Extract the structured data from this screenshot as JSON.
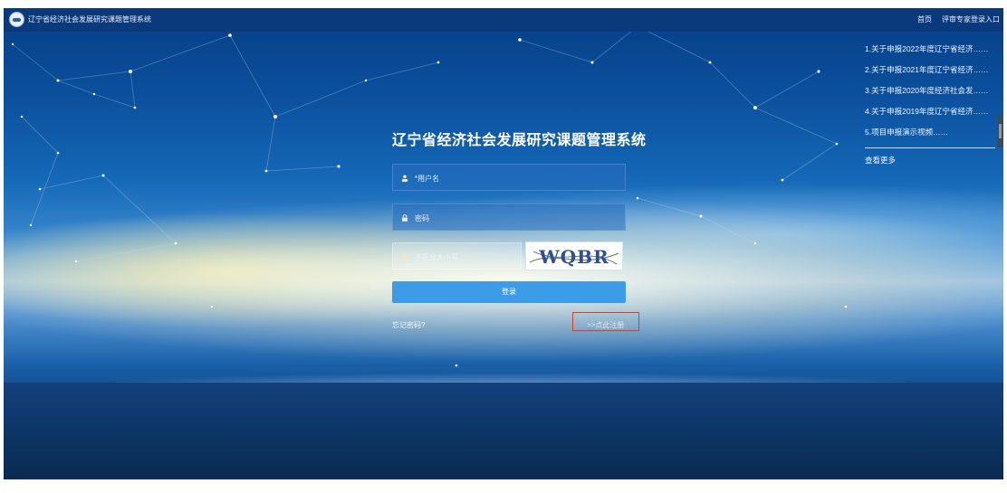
{
  "header": {
    "app_title": "辽宁省经济社会发展研究课题管理系统",
    "nav": {
      "home": "首页",
      "expert_login": "评审专家登录入口"
    }
  },
  "notices": {
    "items": [
      "1.关于申报2022年度辽宁省经济……",
      "2.关于申报2021年度辽宁省经济……",
      "3.关于申报2020年度经济社会发……",
      "4.关于申报2019年度辽宁省经济……",
      "5.项目申报演示视频……"
    ],
    "more": "查看更多"
  },
  "login": {
    "title": "辽宁省经济社会发展研究课题管理系统",
    "username_placeholder": "*用户名",
    "password_placeholder": "密码",
    "captcha_placeholder": "不区分大小写",
    "captcha_text": "WQBR",
    "submit": "登录",
    "forgot": "忘记密码?",
    "register": ">>点此注册"
  },
  "colors": {
    "topbar": "#0b3a7c",
    "button": "#3d9ce8",
    "highlight": "#e03a2a"
  },
  "icons": {
    "logo": "emblem-icon",
    "user": "user-icon",
    "lock": "lock-icon",
    "captcha": "shield-icon"
  }
}
